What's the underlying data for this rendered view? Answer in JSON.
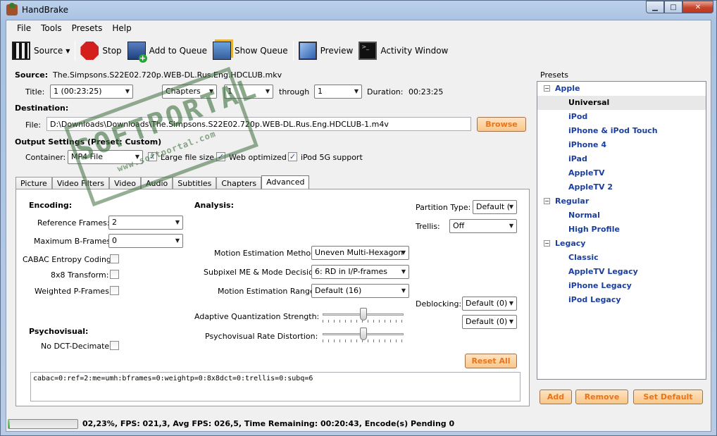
{
  "window": {
    "title": "HandBrake"
  },
  "menu": [
    "File",
    "Tools",
    "Presets",
    "Help"
  ],
  "toolbar": {
    "source": "Source",
    "stop": "Stop",
    "add_to_queue": "Add to Queue",
    "show_queue": "Show Queue",
    "preview": "Preview",
    "activity_window": "Activity Window"
  },
  "source": {
    "label": "Source:",
    "value": "The.Simpsons.S22E02.720p.WEB-DL.Rus.Eng.HDCLUB.mkv",
    "title_label": "Title:",
    "title_value": "1 (00:23:25)",
    "chapters_mode": "Chapters",
    "chapter_start": "1",
    "through_label": "through",
    "chapter_end": "1",
    "duration_label": "Duration:",
    "duration_value": "00:23:25"
  },
  "destination": {
    "label": "Destination:",
    "file_label": "File:",
    "file_value": "D:\\Downloads\\Downloads\\The.Simpsons.S22E02.720p.WEB-DL.Rus.Eng.HDCLUB-1.m4v",
    "browse": "Browse"
  },
  "output": {
    "label": "Output Settings (Preset: Custom)",
    "container_label": "Container:",
    "container_value": "MP4 File",
    "large_file": "Large file size",
    "web_optimized": "Web optimized",
    "ipod": "iPod 5G support"
  },
  "tabs": [
    "Picture",
    "Video Filters",
    "Video",
    "Audio",
    "Subtitles",
    "Chapters",
    "Advanced"
  ],
  "advanced": {
    "encoding_label": "Encoding:",
    "ref_frames_label": "Reference Frames:",
    "ref_frames_value": "2",
    "max_bframes_label": "Maximum B-Frames:",
    "max_bframes_value": "0",
    "cabac_label": "CABAC Entropy Coding:",
    "transform_label": "8x8 Transform:",
    "weighted_label": "Weighted P-Frames:",
    "psychovisual_label": "Psychovisual:",
    "no_dct_label": "No DCT-Decimate:",
    "analysis_label": "Analysis:",
    "me_method_label": "Motion Estimation Method:",
    "me_method_value": "Uneven Multi-Hexagon",
    "subpixel_label": "Subpixel ME & Mode Decision:",
    "subpixel_value": "6: RD in I/P-frames",
    "me_range_label": "Motion Estimation Range:",
    "me_range_value": "Default (16)",
    "aq_label": "Adaptive Quantization Strength:",
    "aq_level": 0.5,
    "psy_rd_label": "Psychovisual Rate Distortion:",
    "psy_rd_level": 0.5,
    "partition_label": "Partition Type:",
    "partition_value": "Default (",
    "trellis_label": "Trellis:",
    "trellis_value": "Off",
    "deblocking_label": "Deblocking:",
    "deblock_1": "Default (0)",
    "deblock_2": "Default (0)",
    "reset_all": "Reset All",
    "option_string": "cabac=0:ref=2:me=umh:bframes=0:weightp=0:8x8dct=0:trellis=0:subq=6"
  },
  "presets": {
    "title": "Presets",
    "groups": [
      {
        "name": "Apple",
        "items": [
          "Universal",
          "iPod",
          "iPhone & iPod Touch",
          "iPhone 4",
          "iPad",
          "AppleTV",
          "AppleTV 2"
        ]
      },
      {
        "name": "Regular",
        "items": [
          "Normal",
          "High Profile"
        ]
      },
      {
        "name": "Legacy",
        "items": [
          "Classic",
          "AppleTV Legacy",
          "iPhone Legacy",
          "iPod Legacy"
        ]
      }
    ],
    "selected": "Universal",
    "add": "Add",
    "remove": "Remove",
    "set_default": "Set Default"
  },
  "status": {
    "progress_fraction": 0.0223,
    "text": "02,23%,  FPS: 021,3,  Avg FPS: 026,5,  Time Remaining: 00:20:43,  Encode(s) Pending 0"
  },
  "watermark": {
    "text": "SOFTPORTAL",
    "sub": "www.softportal.com"
  },
  "colors": {
    "accent_button": "#e8741b",
    "preset_link": "#1b3fa0",
    "progress": "#3cba3c"
  }
}
